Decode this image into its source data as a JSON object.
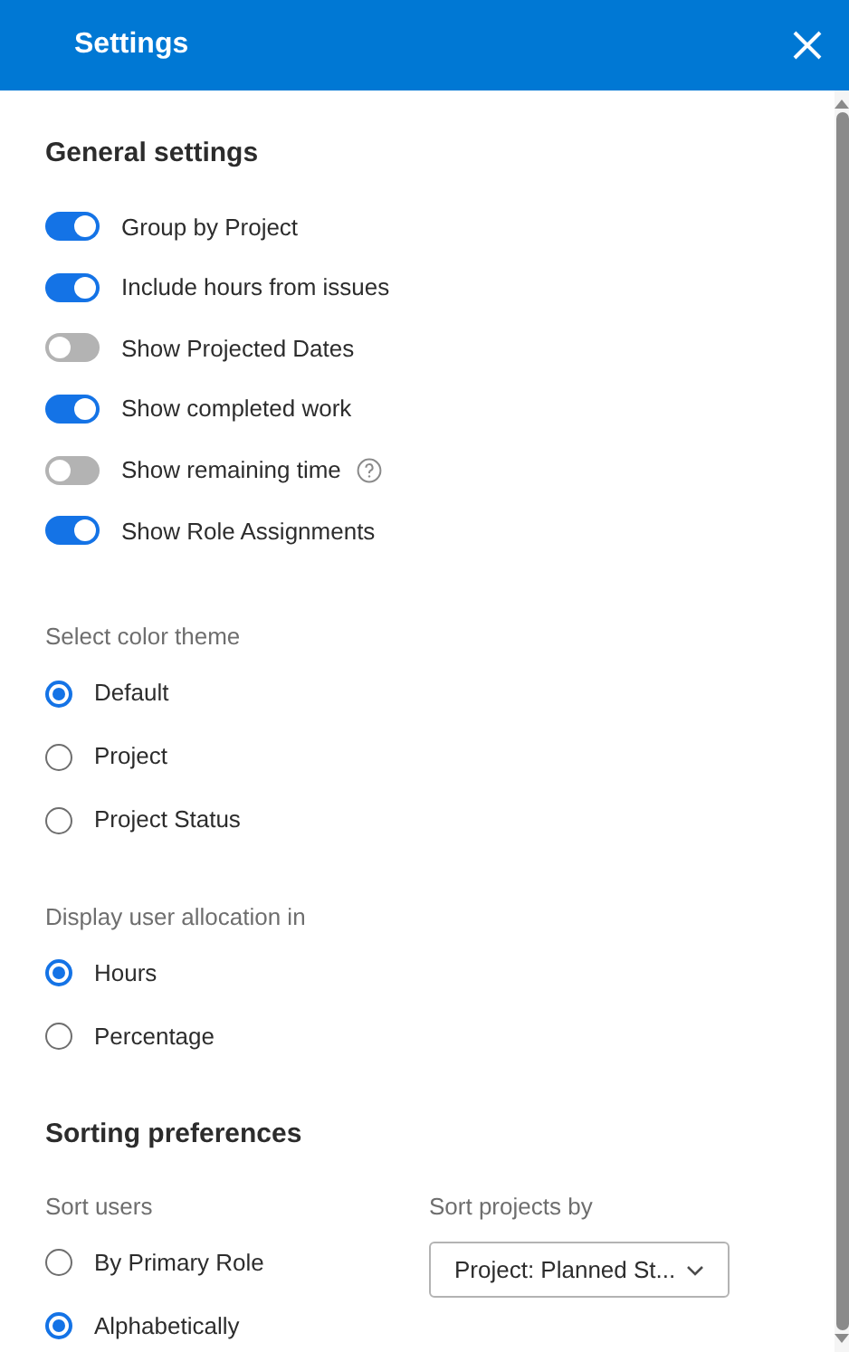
{
  "header": {
    "title": "Settings"
  },
  "general": {
    "heading": "General settings",
    "toggles": [
      {
        "label": "Group by Project",
        "on": true
      },
      {
        "label": "Include hours from issues",
        "on": true
      },
      {
        "label": "Show Projected Dates",
        "on": false
      },
      {
        "label": "Show completed work",
        "on": true
      },
      {
        "label": "Show remaining time",
        "on": false,
        "help": true
      },
      {
        "label": "Show Role Assignments",
        "on": true
      }
    ]
  },
  "color_theme": {
    "label": "Select color theme",
    "options": [
      {
        "label": "Default",
        "selected": true
      },
      {
        "label": "Project",
        "selected": false
      },
      {
        "label": "Project Status",
        "selected": false
      }
    ]
  },
  "allocation": {
    "label": "Display user allocation in",
    "options": [
      {
        "label": "Hours",
        "selected": true
      },
      {
        "label": "Percentage",
        "selected": false
      }
    ]
  },
  "sorting": {
    "heading": "Sorting preferences",
    "sort_users": {
      "label": "Sort users",
      "options": [
        {
          "label": "By Primary Role",
          "selected": false
        },
        {
          "label": "Alphabetically",
          "selected": true
        }
      ]
    },
    "sort_projects": {
      "label": "Sort projects by",
      "value": "Project: Planned St..."
    }
  }
}
